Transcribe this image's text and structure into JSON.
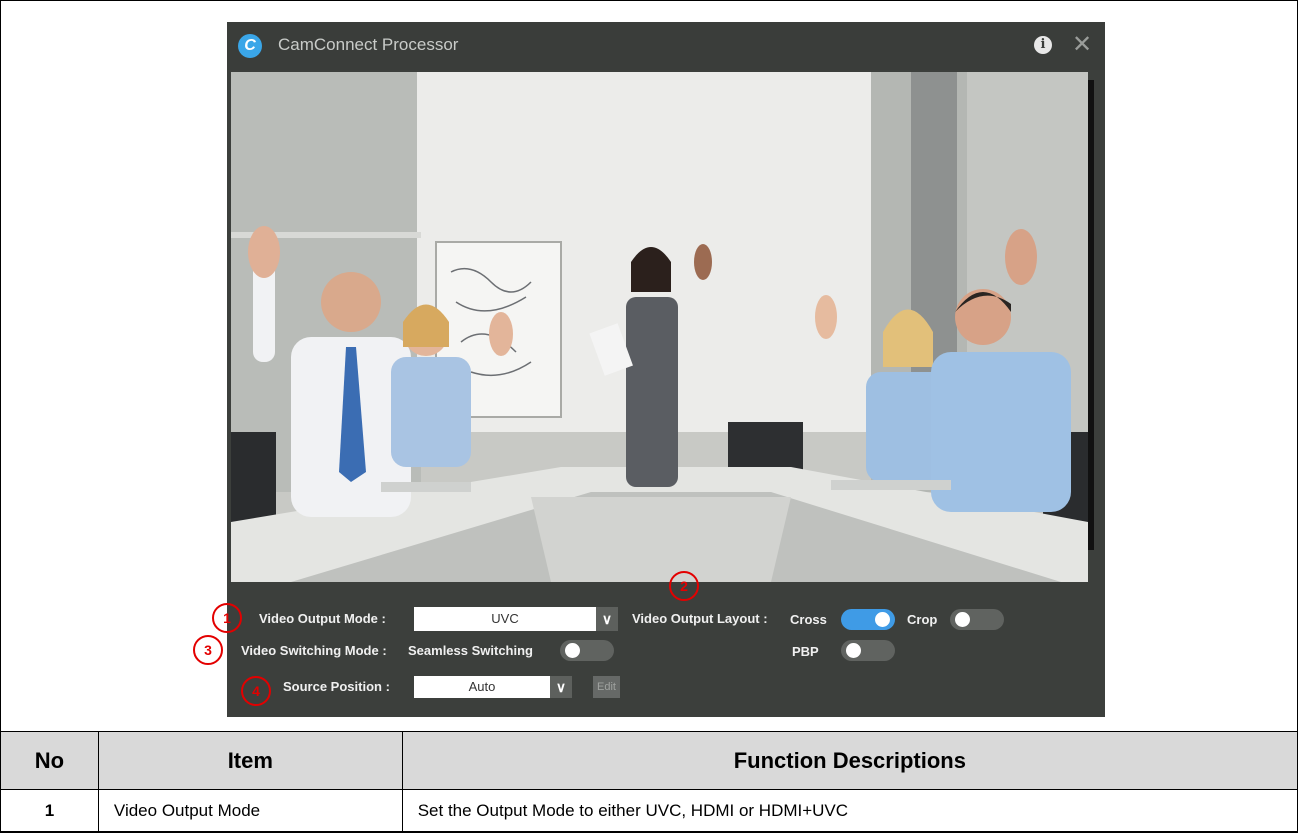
{
  "app": {
    "title": "CamConnect Processor",
    "logo_letter": "C"
  },
  "controls": {
    "video_output_mode_label": "Video Output Mode :",
    "video_output_mode_value": "UVC",
    "video_output_layout_label": "Video Output Layout :",
    "cross_label": "Cross",
    "cross_on": true,
    "crop_label": "Crop",
    "crop_on": false,
    "pbp_label": "PBP",
    "pbp_on": false,
    "video_switching_mode_label": "Video Switching Mode :",
    "seamless_switching_label": "Seamless Switching",
    "seamless_switching_on": false,
    "source_position_label": "Source Position :",
    "source_position_value": "Auto",
    "edit_label": "Edit"
  },
  "callouts": [
    "1",
    "2",
    "3",
    "4"
  ],
  "table": {
    "headers": [
      "No",
      "Item",
      "Function Descriptions"
    ],
    "rows": [
      {
        "no": "1",
        "item": "Video Output Mode",
        "description": "Set the Output Mode to either UVC, HDMI or HDMI+UVC"
      }
    ]
  },
  "colors": {
    "accent": "#3f9be6",
    "callout": "#e30000",
    "window_bg": "#3c3f3c"
  },
  "icons": {
    "info": "info-icon",
    "close": "close-icon",
    "dropdown": "chevron-down-icon"
  }
}
